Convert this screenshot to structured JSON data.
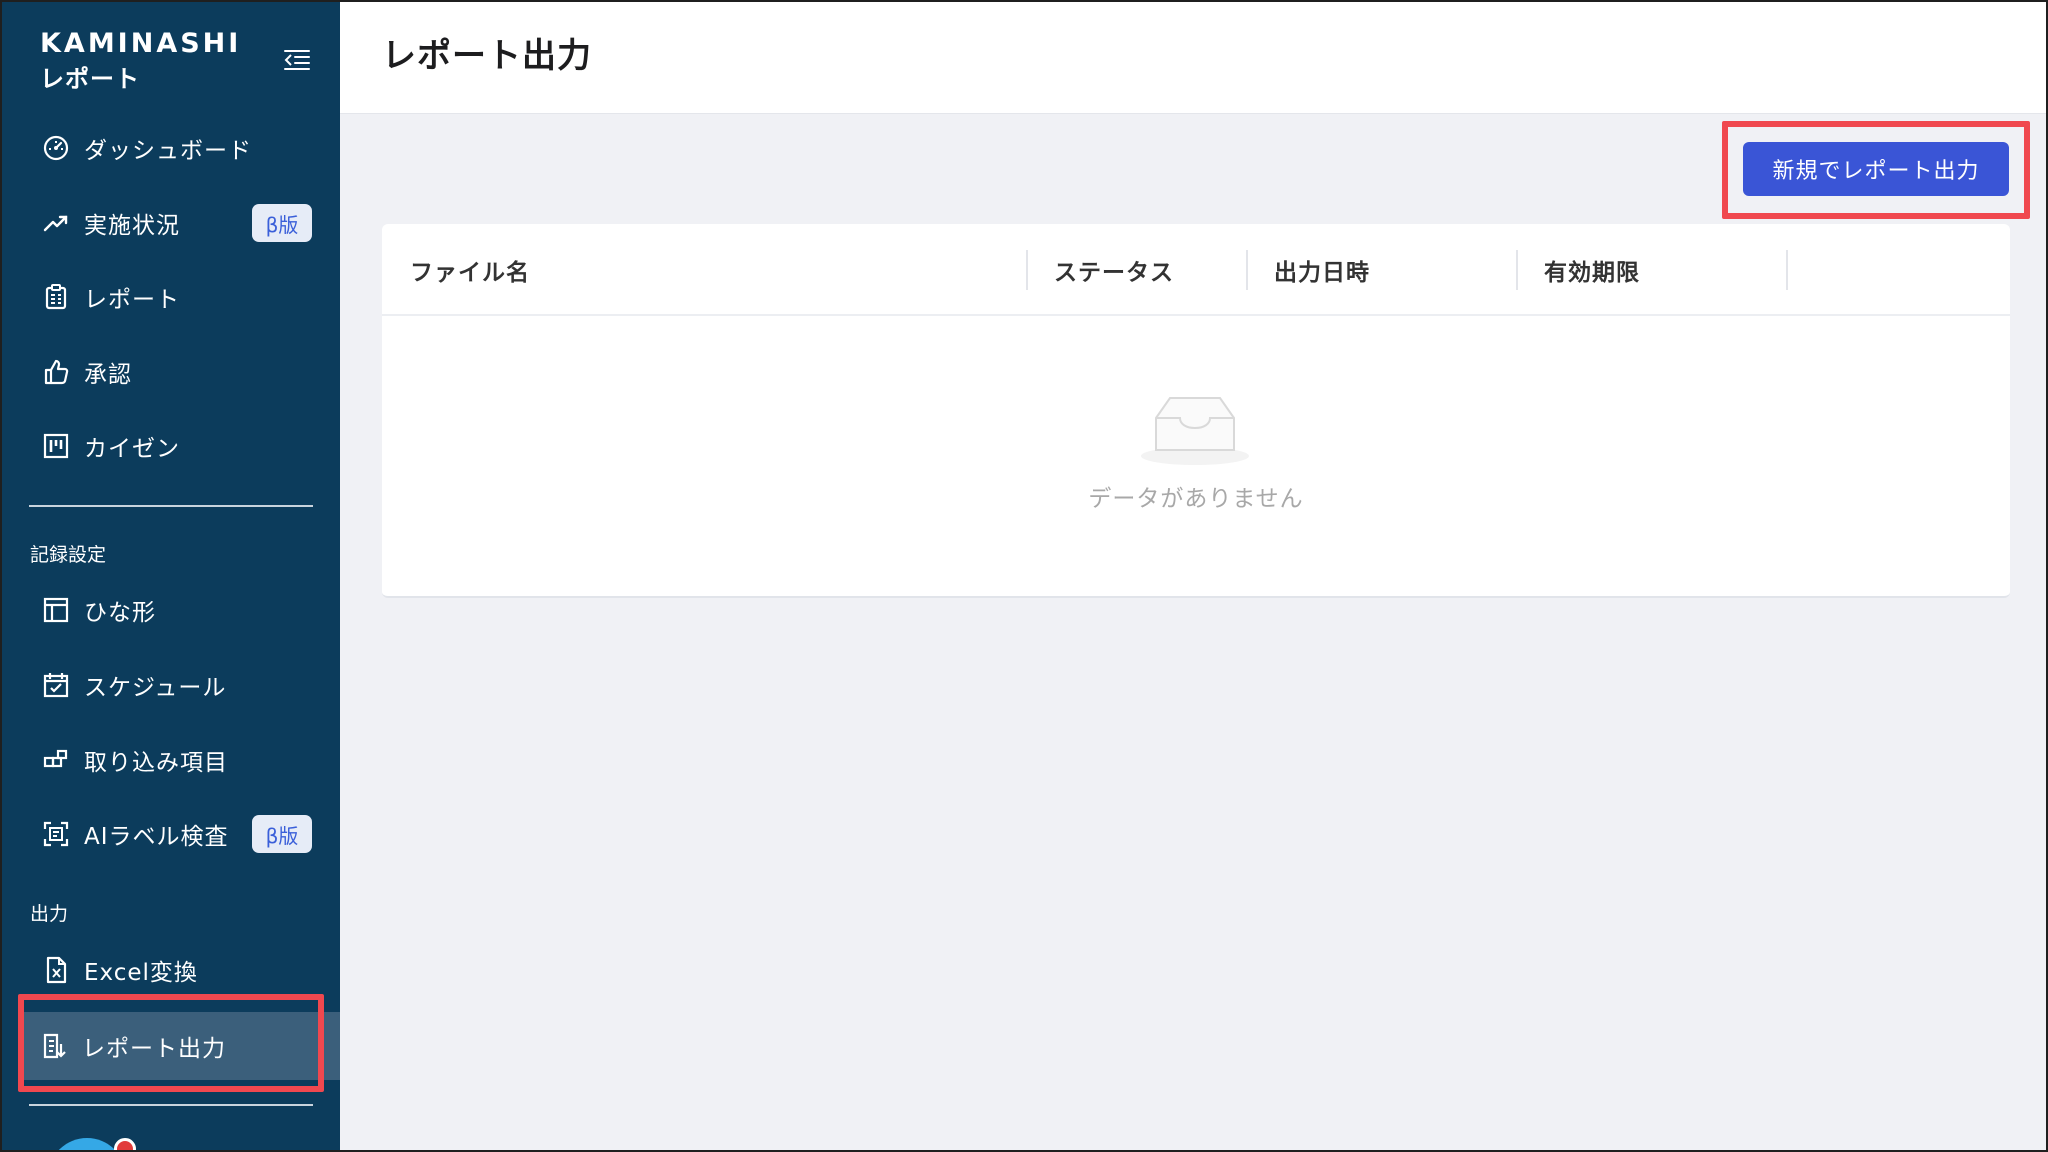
{
  "app": {
    "brand_top": "KAMINASHI",
    "brand_bottom": "レポート"
  },
  "sidebar": {
    "items": [
      {
        "label": "ダッシュボード",
        "icon": "dashboard-gauge-icon"
      },
      {
        "label": "実施状況",
        "icon": "trend-line-icon",
        "badge": "β版"
      },
      {
        "label": "レポート",
        "icon": "clipboard-report-icon"
      },
      {
        "label": "承認",
        "icon": "thumbs-up-icon"
      },
      {
        "label": "カイゼン",
        "icon": "kanban-board-icon"
      }
    ],
    "section_record": "記録設定",
    "record_items": [
      {
        "label": "ひな形",
        "icon": "template-layout-icon"
      },
      {
        "label": "スケジュール",
        "icon": "calendar-check-icon"
      },
      {
        "label": "取り込み項目",
        "icon": "import-blocks-icon"
      },
      {
        "label": "AIラベル検査",
        "icon": "ai-scan-icon",
        "badge": "β版"
      }
    ],
    "section_output": "出力",
    "output_items": [
      {
        "label": "Excel変換",
        "icon": "excel-file-icon"
      },
      {
        "label": "レポート出力",
        "icon": "report-export-icon",
        "active": true
      }
    ]
  },
  "header": {
    "title": "レポート出力"
  },
  "main": {
    "new_button_label": "新規でレポート出力",
    "table": {
      "columns": [
        "ファイル名",
        "ステータス",
        "出力日時",
        "有効期限"
      ],
      "empty_text": "データがありません"
    }
  },
  "colors": {
    "sidebar_bg": "#0c3c5c",
    "primary": "#3a55d6",
    "highlight": "#f0484f",
    "badge_bg": "#e6ecf7",
    "badge_text": "#3a5fd9"
  }
}
